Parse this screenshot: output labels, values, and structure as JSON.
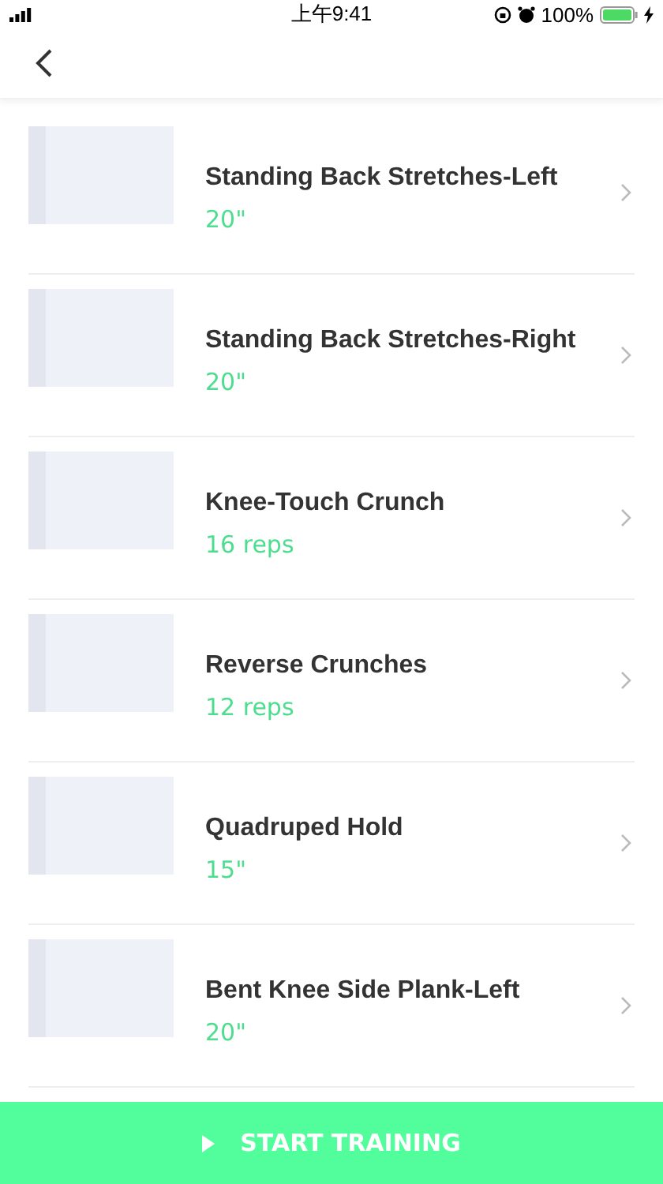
{
  "status_bar": {
    "time": "上午9:41",
    "battery": "100%"
  },
  "exercises": [
    {
      "name": "Standing Back Stretches-Left",
      "amount": "20\""
    },
    {
      "name": "Standing Back Stretches-Right",
      "amount": "20\""
    },
    {
      "name": "Knee-Touch Crunch",
      "amount": "16 reps"
    },
    {
      "name": "Reverse Crunches",
      "amount": "12 reps"
    },
    {
      "name": "Quadruped Hold",
      "amount": "15\""
    },
    {
      "name": "Bent Knee Side Plank-Left",
      "amount": "20\""
    }
  ],
  "start_button": {
    "label": "START TRAINING"
  }
}
